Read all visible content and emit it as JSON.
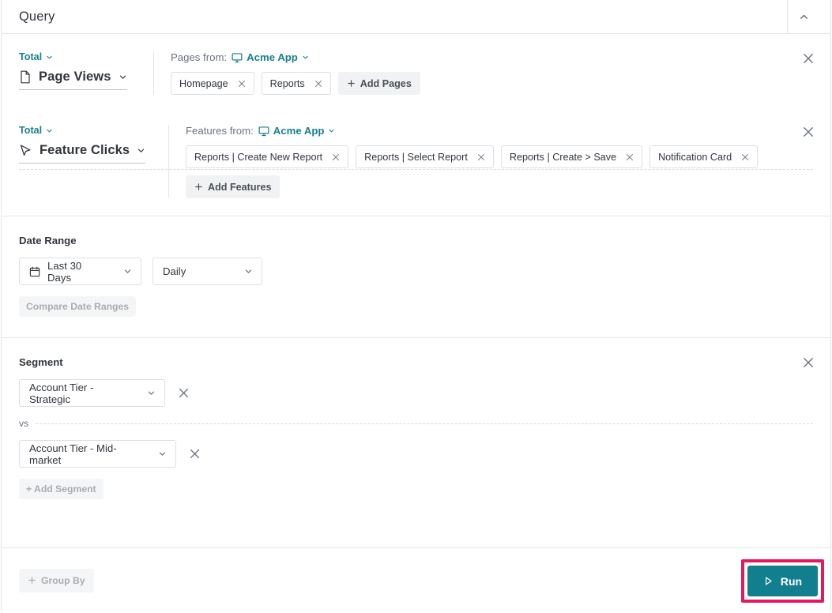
{
  "header": {
    "title": "Query",
    "collapse_icon": "chevron-up-icon"
  },
  "query_rows": [
    {
      "aggregation": "Total",
      "metric": "Page Views",
      "metric_icon": "page-document-icon",
      "items_label": "Pages from:",
      "source": "Acme App",
      "source_icon": "monitor-icon",
      "chips": [
        "Homepage",
        "Reports"
      ],
      "add_label": "Add Pages",
      "remove_icon": "close-icon"
    },
    {
      "aggregation": "Total",
      "metric": "Feature Clicks",
      "metric_icon": "cursor-pointer-icon",
      "items_label": "Features from:",
      "source": "Acme App",
      "source_icon": "monitor-icon",
      "chips": [
        "Reports | Create New Report",
        "Reports | Select Report",
        "Reports | Create > Save",
        "Notification Card"
      ],
      "add_label": "Add Features",
      "remove_icon": "close-icon"
    }
  ],
  "date_range": {
    "title": "Date Range",
    "range_value": "Last 30 Days",
    "range_icon": "calendar-icon",
    "granularity_value": "Daily",
    "compare_label": "Compare Date Ranges"
  },
  "segment": {
    "title": "Segment",
    "segment_1": "Account Tier - Strategic",
    "segment_2": "Account Tier - Mid-market",
    "vs_label": "vs",
    "add_label": "+ Add Segment",
    "remove_icon": "close-icon"
  },
  "footer": {
    "group_by_label": "Group By",
    "run_label": "Run",
    "run_icon": "play-icon"
  },
  "colors": {
    "accent_teal": "#197f8e",
    "run_button": "#127f8f",
    "highlight_pink": "#e8175d",
    "text_primary": "#32363d",
    "text_muted": "#6b7280",
    "border": "#e3e5e8"
  }
}
